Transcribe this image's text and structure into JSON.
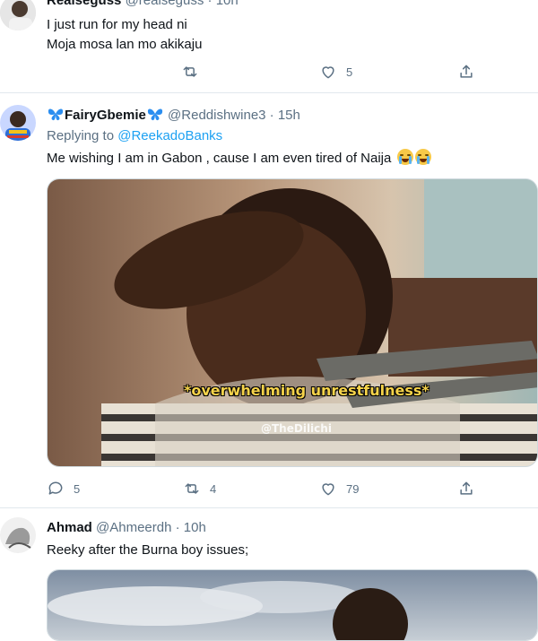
{
  "tweets": [
    {
      "name": "Realseguss",
      "handle": "@realseguss",
      "time": "10h",
      "lines": [
        "I just run for my head ni",
        "Moja mosa lan mo akikaju"
      ],
      "retweets": "",
      "likes": "5"
    },
    {
      "name": "FairyGbemie",
      "name_emoji": "butterfly",
      "handle": "@Reddishwine3",
      "time": "15h",
      "replying_prefix": "Replying to",
      "replying_to": "@ReekadoBanks",
      "text": "Me wishing I am in Gabon , cause I am even tired of Naija",
      "text_emoji": "loudly-crying-face",
      "media_caption": "*overwhelming unrestfulness*",
      "media_watermark": "@TheDilichi",
      "replies": "5",
      "retweets": "4",
      "likes": "79"
    },
    {
      "name": "Ahmad",
      "handle": "@Ahmeerdh",
      "time": "10h",
      "text": "Reeky after the Burna boy issues;"
    }
  ],
  "separator": "·",
  "colors": {
    "link": "#1da1f2",
    "muted": "#5b7083",
    "divider": "#e1e8ed",
    "caption": "#f6d34a"
  }
}
